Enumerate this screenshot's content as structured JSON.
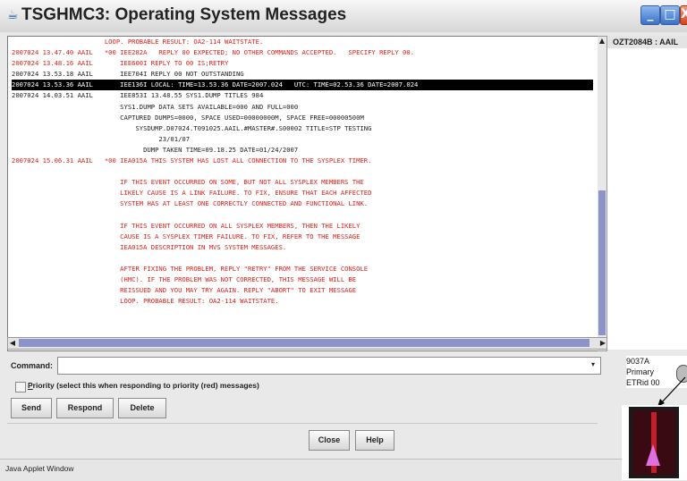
{
  "window": {
    "title": "TSGHMC3: Operating System Messages",
    "controls": {
      "minimize": "_",
      "maximize": "□",
      "close": "X"
    }
  },
  "messages": [
    {
      "text": "                        LOOP. PROBABLE RESULT: OA2-114 WAITSTATE.",
      "color": "red"
    },
    {
      "text": "2007024 13.47.40 AAIL   *00 IEE282A   REPLY 00 EXPECTED; NO OTHER COMMANDS ACCEPTED.   SPECIFY REPLY 00.",
      "color": "red"
    },
    {
      "text": "2007024 13.48.16 AAIL       IEE600I REPLY TO 00 IS;RETRY",
      "color": "red"
    },
    {
      "text": "2007024 13.53.18 AAIL       IEE704I REPLY 00 NOT OUTSTANDING",
      "color": "black"
    },
    {
      "text": "2007024 13.53.36 AAIL       IEE136I LOCAL: TIME=13.53.36 DATE=2007.024   UTC: TIME=02.53.36 DATE=2007.024",
      "color": "selected"
    },
    {
      "text": "2007024 14.03.51 AAIL       IEE853I 13.48.55 SYS1.DUMP TITLES 984",
      "color": "black"
    },
    {
      "text": "                            SYS1.DUMP DATA SETS AVAILABLE=000 AND FULL=000",
      "color": "black"
    },
    {
      "text": "                            CAPTURED DUMPS=0000, SPACE USED=00000000M, SPACE FREE=00000500M",
      "color": "black"
    },
    {
      "text": "                                SYSDUMP.D07024.T091025.AAIL.#MASTER#.S00002 TITLE=STP TESTING",
      "color": "black"
    },
    {
      "text": "                                      23/01/07",
      "color": "black"
    },
    {
      "text": "                                  DUMP TAKEN TIME=09.18.25 DATE=01/24/2007",
      "color": "black"
    },
    {
      "text": "2007024 15.06.31 AAIL   *00 IEA015A THIS SYSTEM HAS LOST ALL CONNECTION TO THE SYSPLEX TIMER.",
      "color": "red"
    },
    {
      "text": "",
      "color": "red"
    },
    {
      "text": "                            IF THIS EVENT OCCURRED ON SOME, BUT NOT ALL SYSPLEX MEMBERS THE",
      "color": "red"
    },
    {
      "text": "                            LIKELY CAUSE IS A LINK FAILURE. TO FIX, ENSURE THAT EACH AFFECTED",
      "color": "red"
    },
    {
      "text": "                            SYSTEM HAS AT LEAST ONE CORRECTLY CONNECTED AND FUNCTIONAL LINK.",
      "color": "red"
    },
    {
      "text": "",
      "color": "red"
    },
    {
      "text": "                            IF THIS EVENT OCCURRED ON ALL SYSPLEX MEMBERS, THEN THE LIKELY",
      "color": "red"
    },
    {
      "text": "                            CAUSE IS A SYSPLEX TIMER FAILURE. TO FIX, REFER TO THE MESSAGE",
      "color": "red"
    },
    {
      "text": "                            IEA015A DESCRIPTION IN MVS SYSTEM MESSAGES.",
      "color": "red"
    },
    {
      "text": "",
      "color": "red"
    },
    {
      "text": "                            AFTER FIXING THE PROBLEM, REPLY \"RETRY\" FROM THE SERVICE CONSOLE",
      "color": "red"
    },
    {
      "text": "                            (HMC). IF THE PROBLEM WAS NOT CORRECTED, THIS MESSAGE WILL BE",
      "color": "red"
    },
    {
      "text": "                            REISSUED AND YOU MAY TRY AGAIN. REPLY \"ABORT\" TO EXIT MESSAGE",
      "color": "red"
    },
    {
      "text": "                            LOOP. PROBABLE RESULT: OA2-114 WAITSTATE.",
      "color": "red"
    }
  ],
  "side_panel": {
    "system": "OZT2084B : AAIL"
  },
  "command": {
    "label": "Command:",
    "value": "",
    "dropdown": "▾"
  },
  "priority": {
    "key": "P",
    "label_rest": "riority (select this when responding to priority (red) messages)",
    "checked": false
  },
  "buttons": {
    "send": "Send",
    "respond": "Respond",
    "delete": "Delete",
    "close": "Close",
    "help": "Help"
  },
  "statusbar": {
    "text": "Java Applet Window"
  },
  "annotation": {
    "line1": "9037A",
    "line2": "Primary",
    "line3": "ETRid 00"
  },
  "colors": {
    "red_message": "#e0201a",
    "selection": "#000000",
    "scroll_thumb": "#8c93c8"
  }
}
